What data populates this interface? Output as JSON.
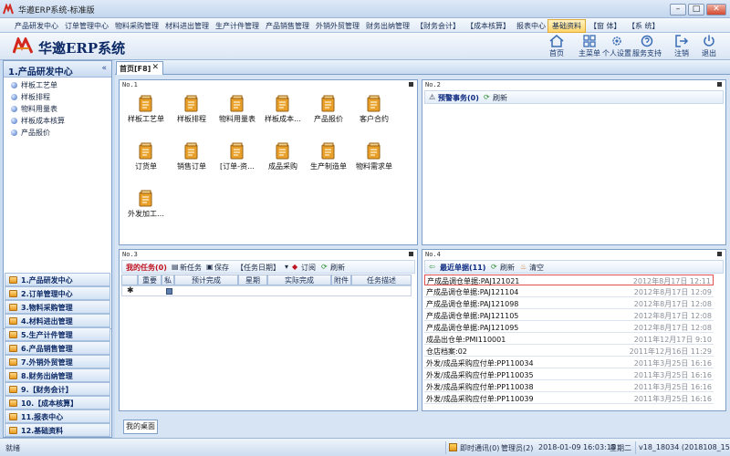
{
  "window": {
    "title": "华邀ERP系统-标准版",
    "controls": [
      "–",
      "□",
      "✕"
    ]
  },
  "menu": [
    {
      "label": "产品研发中心"
    },
    {
      "label": "订单管理中心"
    },
    {
      "label": "物料采购管理"
    },
    {
      "label": "材料进出管理"
    },
    {
      "label": "生产计件管理"
    },
    {
      "label": "产品销售管理"
    },
    {
      "label": "外销外贸管理"
    },
    {
      "label": "财务出纳管理"
    },
    {
      "label": "【财务会计】"
    },
    {
      "label": "【成本核算】"
    },
    {
      "label": "报表中心"
    },
    {
      "label": "基础资料"
    },
    {
      "label": "【窗 体】"
    },
    {
      "label": "【系 统】"
    }
  ],
  "brand": {
    "name": "华邀ERP系统"
  },
  "toolbar": [
    {
      "label": "首页",
      "icon": "home-icon"
    },
    {
      "label": "主菜单",
      "icon": "grid-icon"
    },
    {
      "label": "个人设置",
      "icon": "gear-icon"
    },
    {
      "label": "服务支持",
      "icon": "support-icon"
    },
    {
      "label": "注销",
      "icon": "logout-icon"
    },
    {
      "label": "退出",
      "icon": "power-icon"
    }
  ],
  "leftnav": {
    "header": "1.产品研发中心",
    "collapse": "«",
    "tree": [
      "样板工艺单",
      "样板排程",
      "物料用量表",
      "样板成本核算",
      "产品报价"
    ],
    "groups": [
      "1.产品研发中心",
      "2.订单管理中心",
      "3.物料采购管理",
      "4.材料进出管理",
      "5.生产计件管理",
      "6.产品销售管理",
      "7.外销外贸管理",
      "8.财务出纳管理",
      "9.【财务会计】",
      "10.【成本核算】",
      "11.报表中心",
      "12.基础资料"
    ]
  },
  "tabs": {
    "home": "首页[F8]",
    "close": "✕",
    "desktop": "我的桌面"
  },
  "panel1": {
    "title": "No.1",
    "shortcuts": [
      "样板工艺单",
      "样板排程",
      "物料用量表",
      "样板成本…",
      "产品报价",
      "客户合约",
      "订货单",
      "销售订单",
      "[订单-资…",
      "成品采购",
      "生产制造单",
      "物料需求单",
      "外发加工…"
    ]
  },
  "panel2": {
    "title": "No.2",
    "alerts": "预警事务(0)",
    "refresh": "刷新"
  },
  "panel3": {
    "title": "No.3",
    "toolbar": {
      "mytasks": "我的任务(0)",
      "newtask": "新任务",
      "save": "保存",
      "taskdate": "【任务日期】",
      "subscribe": "订阅",
      "refresh": "刷新"
    },
    "columns": [
      "重要",
      "私",
      "预计完成",
      "星期",
      "实际完成",
      "附件",
      "任务描述"
    ],
    "newrow_marker": "✱"
  },
  "panel4": {
    "title": "No.4",
    "toolbar": {
      "recent": "最近单据(11)",
      "refresh": "刷新",
      "clear": "清空"
    },
    "records": [
      {
        "text": "产成品调仓单据:PAJ121021",
        "date": "2012年8月17日 12:11"
      },
      {
        "text": "产成品调仓单据:PAJ121104",
        "date": "2012年8月17日 12:09"
      },
      {
        "text": "产成品调仓单据:PAJ121098",
        "date": "2012年8月17日 12:08"
      },
      {
        "text": "产成品调仓单据:PAJ121105",
        "date": "2012年8月17日 12:08"
      },
      {
        "text": "产成品调仓单据:PAJ121095",
        "date": "2012年8月17日 12:08"
      },
      {
        "text": "成品出仓单:PMI110001",
        "date": "2011年12月17日 9:10"
      },
      {
        "text": "仓店档案:02",
        "date": "2011年12月16日 11:29"
      },
      {
        "text": "外发/成品采购应付单:PP110034",
        "date": "2011年3月25日 16:16"
      },
      {
        "text": "外发/成品采购应付单:PP110035",
        "date": "2011年3月25日 16:16"
      },
      {
        "text": "外发/成品采购应付单:PP110038",
        "date": "2011年3月25日 16:16"
      },
      {
        "text": "外发/成品采购应付单:PP110039",
        "date": "2011年3月25日 16:16"
      }
    ]
  },
  "status": {
    "ready": "就绪",
    "im": "即时通讯(0)",
    "user": "管理员(2)",
    "datetime": "2018-01-09 16:03:15",
    "weekday": "星期二",
    "version": "v18_18034 (2018108_15)"
  },
  "colors": {
    "accent": "#0d2a66",
    "alert_red": "#c1121f",
    "active_menu": "#ffd56a"
  }
}
